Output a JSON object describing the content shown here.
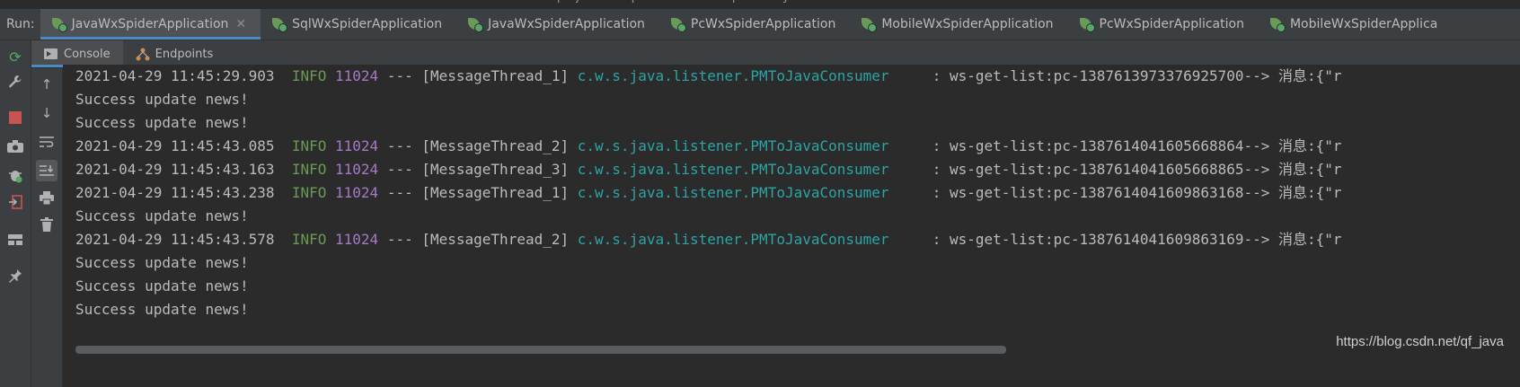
{
  "breadcrumb": [
    "project",
    "dependencies",
    "dependency",
    "artifactId"
  ],
  "run": {
    "label": "Run:",
    "tabs": [
      {
        "label": "JavaWxSpiderApplication",
        "active": true,
        "closable": true
      },
      {
        "label": "SqlWxSpiderApplication",
        "active": false
      },
      {
        "label": "JavaWxSpiderApplication",
        "active": false
      },
      {
        "label": "PcWxSpiderApplication",
        "active": false
      },
      {
        "label": "MobileWxSpiderApplication",
        "active": false
      },
      {
        "label": "PcWxSpiderApplication",
        "active": false
      },
      {
        "label": "MobileWxSpiderApplica",
        "active": false
      }
    ]
  },
  "subtabs": {
    "console": "Console",
    "endpoints": "Endpoints"
  },
  "log": [
    {
      "type": "entry",
      "ts": "2021-04-29 11:45:29.903",
      "level": "INFO",
      "pid": "11024",
      "sep": "---",
      "thread": "[MessageThread_1]",
      "cls": "c.w.s.java.listener.PMToJavaConsumer",
      "msg": ": ws-get-list:pc-1387613973376925700--> 消息:{\"r"
    },
    {
      "type": "plain",
      "text": "Success update news!"
    },
    {
      "type": "plain",
      "text": "Success update news!"
    },
    {
      "type": "entry",
      "ts": "2021-04-29 11:45:43.085",
      "level": "INFO",
      "pid": "11024",
      "sep": "---",
      "thread": "[MessageThread_2]",
      "cls": "c.w.s.java.listener.PMToJavaConsumer",
      "msg": ": ws-get-list:pc-1387614041605668864--> 消息:{\"r"
    },
    {
      "type": "entry",
      "ts": "2021-04-29 11:45:43.163",
      "level": "INFO",
      "pid": "11024",
      "sep": "---",
      "thread": "[MessageThread_3]",
      "cls": "c.w.s.java.listener.PMToJavaConsumer",
      "msg": ": ws-get-list:pc-1387614041605668865--> 消息:{\"r"
    },
    {
      "type": "entry",
      "ts": "2021-04-29 11:45:43.238",
      "level": "INFO",
      "pid": "11024",
      "sep": "---",
      "thread": "[MessageThread_1]",
      "cls": "c.w.s.java.listener.PMToJavaConsumer",
      "msg": ": ws-get-list:pc-1387614041609863168--> 消息:{\"r"
    },
    {
      "type": "plain",
      "text": "Success update news!"
    },
    {
      "type": "entry",
      "ts": "2021-04-29 11:45:43.578",
      "level": "INFO",
      "pid": "11024",
      "sep": "---",
      "thread": "[MessageThread_2]",
      "cls": "c.w.s.java.listener.PMToJavaConsumer",
      "msg": ": ws-get-list:pc-1387614041609863169--> 消息:{\"r"
    },
    {
      "type": "plain",
      "text": "Success update news!"
    },
    {
      "type": "plain",
      "text": "Success update news!"
    },
    {
      "type": "plain",
      "text": "Success update news!"
    }
  ],
  "watermark": "https://blog.csdn.net/qf_java",
  "icons": {
    "left": [
      "rerun-icon",
      "wrench-icon",
      "stop-icon",
      "camera-icon",
      "debug-icon",
      "exit-icon",
      "layout-icon",
      "pin-icon"
    ],
    "console": [
      "scroll-up-icon",
      "scroll-down-icon",
      "soft-wrap-icon",
      "scroll-to-end-icon",
      "print-icon",
      "trash-icon"
    ]
  },
  "colors": {
    "background": "#2b2b2b",
    "toolbar": "#3c3f41",
    "accent": "#4a88c7",
    "info": "#6a9955",
    "pid": "#a679c8",
    "logger": "#2ba5a5"
  }
}
